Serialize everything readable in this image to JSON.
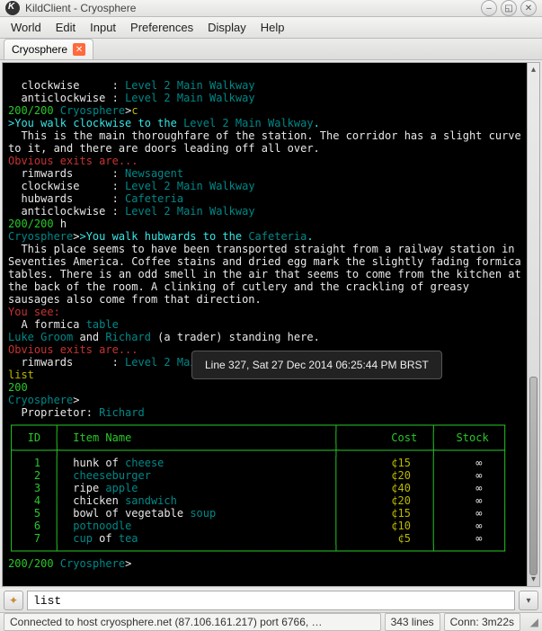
{
  "window": {
    "title": "KildClient - Cryosphere"
  },
  "menu": [
    "World",
    "Edit",
    "Input",
    "Preferences",
    "Display",
    "Help"
  ],
  "tab": {
    "label": "Cryosphere"
  },
  "tooltip": "Line 327, Sat 27 Dec 2014 06:25:44 PM BRST",
  "input_value": "list",
  "status": {
    "conn": "Connected to host cryosphere.net (87.106.161.217) port 6766, …",
    "lines": "343 lines",
    "time": "Conn: 3m22s"
  },
  "hp_full": "200",
  "hp_cur": "200",
  "world": "Cryosphere",
  "cmd_c": "c",
  "cmd_h": "h",
  "cmd_list": "list",
  "exits_pre": {
    "clockwise": {
      "dir": "clockwise",
      "dest": "Level 2 Main Walkway"
    },
    "anticw": {
      "dir": "anticlockwise",
      "dest": "Level 2 Main Walkway"
    }
  },
  "walk1": {
    "pre": ">You walk clockwise to the ",
    "dest": "Level 2 Main Walkway",
    "post": "."
  },
  "desc1a": "  This is the main thoroughfare of the station. The corridor has a slight curve",
  "desc1b": "to it, and there are doors leading off all over.",
  "exits_label": "Obvious exits are...",
  "exits2": [
    {
      "dir": "rimwards",
      "dest": "Newsagent"
    },
    {
      "dir": "clockwise",
      "dest": "Level 2 Main Walkway"
    },
    {
      "dir": "hubwards",
      "dest": "Cafeteria"
    },
    {
      "dir": "anticlockwise",
      "dest": "Level 2 Main Walkway"
    }
  ],
  "walk2": {
    "pre": ">You walk hubwards to the ",
    "dest": "Cafeteria",
    "post": "."
  },
  "desc2": [
    "  This place seems to have been transported straight from a railway station in",
    "Seventies America. Coffee stains and dried egg mark the slightly fading formica",
    "tables. There is an odd smell in the air that seems to come from the kitchen at",
    "the back of the room. A clinking of cutlery and the crackling of greasy",
    "sausages also come from that direction."
  ],
  "you_see": "You see:",
  "formica": {
    "a": "  A formica ",
    "b": "table"
  },
  "people": {
    "p1": "Luke Groom",
    "mid": " and ",
    "p2": "Richard",
    "tail": " (a trader) standing here."
  },
  "exits3": {
    "dir": "rimwards",
    "dest": "Level 2 Main Walkway"
  },
  "shop": {
    "prop_label": "Proprietor",
    "prop_name": "Richard",
    "cols": {
      "id": "ID",
      "name": "Item Name",
      "cost": "Cost",
      "stock": "Stock"
    },
    "rows": [
      {
        "id": "1",
        "pre": "hunk of ",
        "hl": "cheese",
        "post": "",
        "cost": "¢15",
        "stock": "∞"
      },
      {
        "id": "2",
        "pre": "",
        "hl": "cheeseburger",
        "post": "",
        "cost": "¢20",
        "stock": "∞"
      },
      {
        "id": "3",
        "pre": "ripe ",
        "hl": "apple",
        "post": "",
        "cost": "¢40",
        "stock": "∞"
      },
      {
        "id": "4",
        "pre": "chicken ",
        "hl": "sandwich",
        "post": "",
        "cost": "¢20",
        "stock": "∞"
      },
      {
        "id": "5",
        "pre": "bowl of vegetable ",
        "hl": "soup",
        "post": "",
        "cost": "¢15",
        "stock": "∞"
      },
      {
        "id": "6",
        "pre": "",
        "hl": "potnoodle",
        "post": "",
        "cost": "¢10",
        "stock": "∞"
      },
      {
        "id": "7",
        "pre": "",
        "hl": "cup",
        "post": " of ",
        "hl2": "tea",
        "cost": "¢5",
        "stock": "∞"
      }
    ]
  }
}
